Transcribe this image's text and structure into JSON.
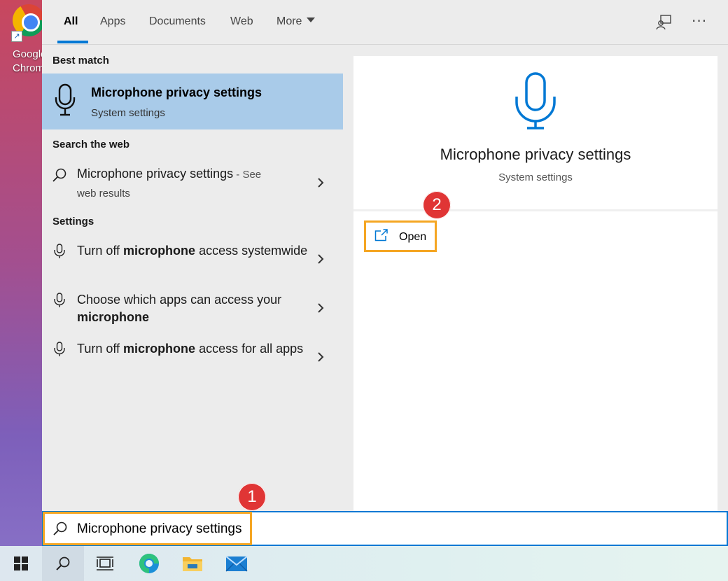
{
  "desktop": {
    "shortcut_label": "Google Chrome",
    "shortcut_icon": "chrome-icon"
  },
  "tabs": {
    "all": "All",
    "apps": "Apps",
    "documents": "Documents",
    "web": "Web",
    "more": "More",
    "feedback_icon": "feedback-icon",
    "more_options": "···"
  },
  "left": {
    "best_match_header": "Best match",
    "best_match": {
      "title": "Microphone privacy settings",
      "subtitle": "System settings",
      "icon": "microphone-icon"
    },
    "search_web_header": "Search the web",
    "web_result": {
      "text": "Microphone privacy settings",
      "suffix": " - See",
      "sub": "web results",
      "icon": "search-icon"
    },
    "settings_header": "Settings",
    "settings_items": [
      {
        "pre": "Turn off ",
        "bold": "microphone",
        "post": " access systemwide"
      },
      {
        "pre": "Choose which apps can access your ",
        "bold": "microphone",
        "post": ""
      },
      {
        "pre": "Turn off ",
        "bold": "microphone",
        "post": " access for all apps"
      }
    ]
  },
  "detail": {
    "title": "Microphone privacy settings",
    "subtitle": "System settings",
    "open_label": "Open",
    "icon": "microphone-icon"
  },
  "annotations": {
    "step1": "1",
    "step2": "2",
    "highlight_color": "#f5a623",
    "badge_color": "#e03535"
  },
  "search": {
    "value": "Microphone privacy settings"
  },
  "taskbar": {
    "items": [
      "start-icon",
      "search-icon",
      "task-view-icon",
      "edge-icon",
      "file-explorer-icon",
      "mail-icon"
    ]
  },
  "colors": {
    "accent": "#0078d4",
    "selected_bg": "#a9cbe9",
    "panel_bg": "#ececec"
  }
}
